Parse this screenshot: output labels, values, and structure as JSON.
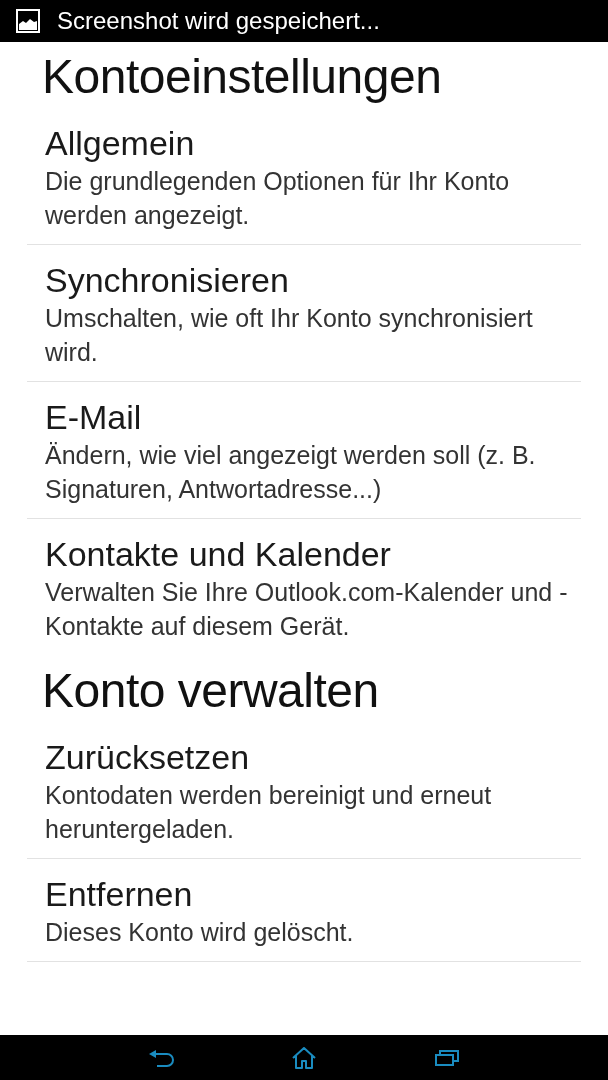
{
  "status_bar": {
    "notification": "Screenshot wird gespeichert..."
  },
  "sections": [
    {
      "heading": "Kontoeinstellungen",
      "items": [
        {
          "title": "Allgemein",
          "description": "Die grundlegenden Optionen für Ihr Konto werden angezeigt.",
          "divider": true
        },
        {
          "title": "Synchronisieren",
          "description": "Umschalten, wie oft Ihr Konto synchronisiert wird.",
          "divider": true
        },
        {
          "title": "E-Mail",
          "description": "Ändern, wie viel angezeigt werden soll (z. B. Signaturen, Antwortadresse...)",
          "divider": true
        },
        {
          "title": "Kontakte und Kalender",
          "description": "Verwalten Sie Ihre Outlook.com-Kalender und -Kontakte auf diesem Gerät.",
          "divider": false
        }
      ]
    },
    {
      "heading": "Konto verwalten",
      "items": [
        {
          "title": "Zurücksetzen",
          "description": "Kontodaten werden bereinigt und erneut heruntergeladen.",
          "divider": true
        },
        {
          "title": "Entfernen",
          "description": "Dieses Konto wird gelöscht.",
          "divider": true
        }
      ]
    }
  ],
  "nav_bar": {
    "buttons": [
      {
        "kind": "back"
      },
      {
        "kind": "home"
      },
      {
        "kind": "recent"
      }
    ]
  }
}
